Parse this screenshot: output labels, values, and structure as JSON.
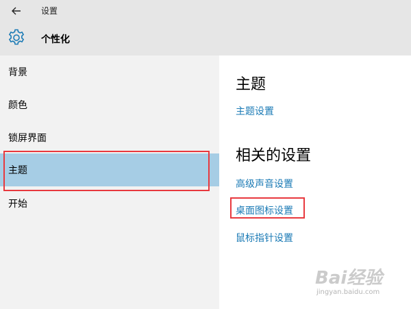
{
  "window": {
    "title": "设置"
  },
  "header": {
    "icon": "gear-icon",
    "title": "个性化"
  },
  "sidebar": {
    "items": [
      {
        "label": "背景"
      },
      {
        "label": "颜色"
      },
      {
        "label": "锁屏界面"
      },
      {
        "label": "主题",
        "selected": true
      },
      {
        "label": "开始"
      }
    ]
  },
  "content": {
    "theme_heading": "主题",
    "theme_settings_link": "主题设置",
    "related_heading": "相关的设置",
    "links": [
      "高级声音设置",
      "桌面图标设置",
      "鼠标指针设置"
    ]
  },
  "watermark": {
    "brand": "Bai经验",
    "url": "jingyan.baidu.com"
  },
  "colors": {
    "accent_link": "#1a7ab5",
    "selected_bg": "#a6cde5",
    "highlight_box": "#e8383d",
    "chrome_bg": "#e6e6e6"
  }
}
